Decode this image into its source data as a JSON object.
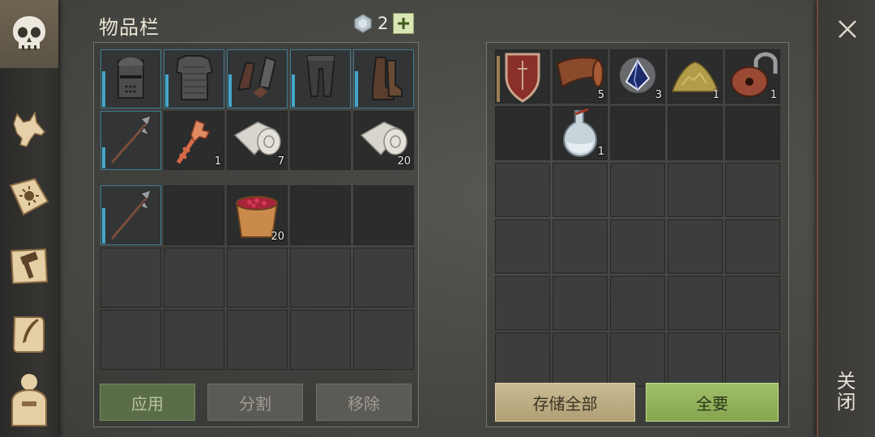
{
  "title": "物品栏",
  "currency": {
    "amount": "2",
    "icon": "gem-icon"
  },
  "close_label": "关闭",
  "inventory": {
    "equipment": [
      {
        "icon": "knight-helmet-icon",
        "count": ""
      },
      {
        "icon": "chainmail-armor-icon",
        "count": ""
      },
      {
        "icon": "gauntlets-icon",
        "count": ""
      },
      {
        "icon": "leg-armor-icon",
        "count": ""
      },
      {
        "icon": "boots-icon",
        "count": ""
      },
      {
        "icon": "halberd-icon",
        "count": ""
      },
      {
        "icon": "ornate-key-icon",
        "count": "1"
      },
      {
        "icon": "cloth-roll-icon",
        "count": "7"
      },
      {
        "icon": "",
        "count": ""
      },
      {
        "icon": "cloth-roll-icon",
        "count": "20"
      }
    ],
    "bag": [
      {
        "icon": "halberd-icon",
        "count": ""
      },
      {
        "icon": "",
        "count": ""
      },
      {
        "icon": "berry-bucket-icon",
        "count": "20"
      },
      {
        "icon": "",
        "count": ""
      },
      {
        "icon": "",
        "count": ""
      }
    ]
  },
  "storage": [
    {
      "icon": "shield-icon",
      "count": ""
    },
    {
      "icon": "leather-icon",
      "count": "5"
    },
    {
      "icon": "crystal-icon",
      "count": "3"
    },
    {
      "icon": "sand-pile-icon",
      "count": "1"
    },
    {
      "icon": "padlock-icon",
      "count": "1"
    },
    {
      "icon": "",
      "count": ""
    },
    {
      "icon": "potion-bottle-icon",
      "count": "1"
    }
  ],
  "buttons": {
    "apply": "应用",
    "split": "分割",
    "remove": "移除",
    "store_all": "存储全部",
    "take_all": "全要"
  },
  "sidebar": [
    "skull-icon",
    "wolf-icon",
    "sun-book-icon",
    "hammer-map-icon",
    "scroll-quill-icon",
    "character-icon"
  ],
  "colors": {
    "equip_outline": "#3f7d94",
    "durability_bar": "#46a6c9",
    "take_all_green": "#86a54f",
    "store_all_tan": "#b09f74"
  }
}
